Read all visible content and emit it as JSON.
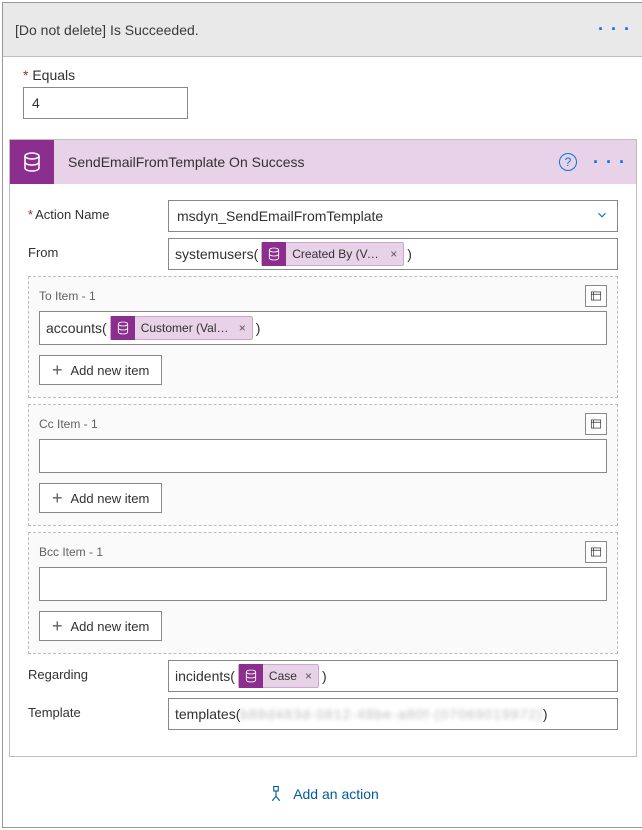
{
  "header": {
    "title": "[Do not delete] Is Succeeded."
  },
  "equals": {
    "label": "Equals",
    "value": "4"
  },
  "card": {
    "title": "SendEmailFromTemplate On Success",
    "fields": {
      "actionName": {
        "label": "Action Name",
        "value": "msdyn_SendEmailFromTemplate"
      },
      "from": {
        "label": "From",
        "prefix": "systemusers(",
        "suffix": ")",
        "token": "Created By (Val…"
      },
      "to": {
        "label": "To Item - 1",
        "prefix": "accounts(",
        "suffix": ")",
        "token": "Customer (Valu…"
      },
      "cc": {
        "label": "Cc Item - 1"
      },
      "bcc": {
        "label": "Bcc Item - 1"
      },
      "regarding": {
        "label": "Regarding",
        "prefix": "incidents(",
        "suffix": ")",
        "token": "Case"
      },
      "template": {
        "label": "Template",
        "prefix": "templates(",
        "suffix": ")",
        "masked": "b88d483d-0812-48be-a80f-(07069019972)"
      }
    },
    "addItem": "Add new item"
  },
  "addAction": "Add an action"
}
